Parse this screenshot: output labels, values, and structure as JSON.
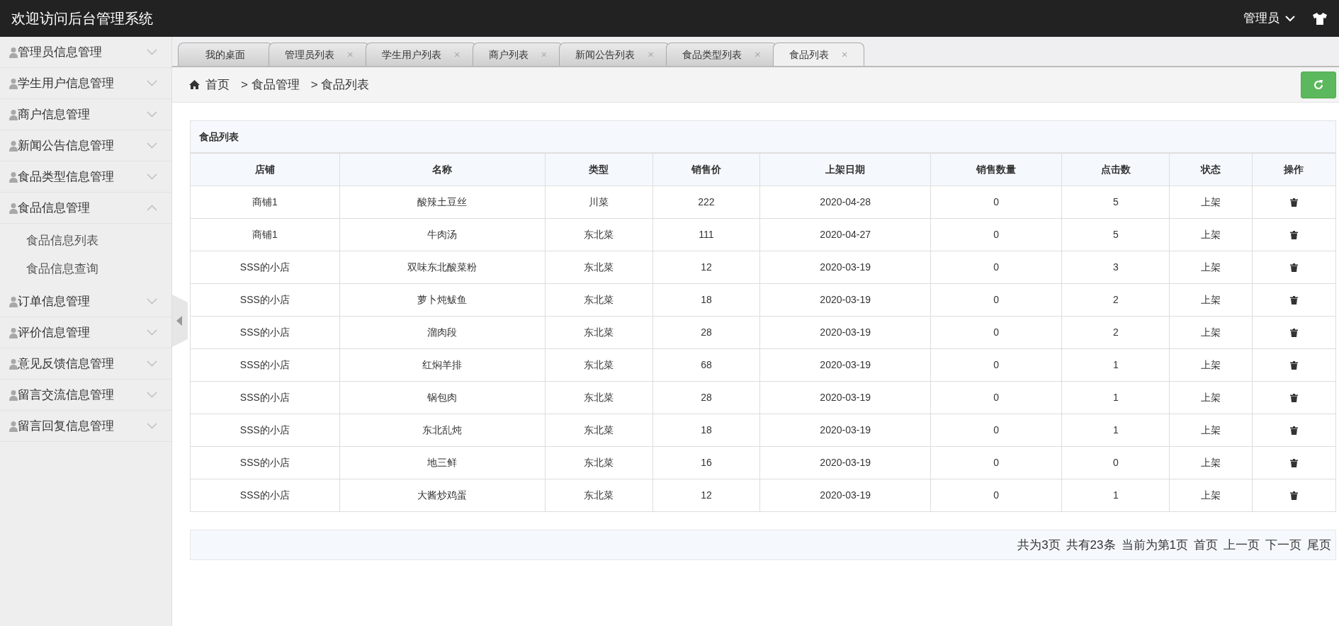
{
  "header": {
    "title": "欢迎访问后台管理系统",
    "user": "管理员"
  },
  "sidebar": {
    "items": [
      {
        "label": "管理员信息管理",
        "expanded": false
      },
      {
        "label": "学生用户信息管理",
        "expanded": false
      },
      {
        "label": "商户信息管理",
        "expanded": false
      },
      {
        "label": "新闻公告信息管理",
        "expanded": false
      },
      {
        "label": "食品类型信息管理",
        "expanded": false
      },
      {
        "label": "食品信息管理",
        "expanded": true,
        "children": [
          {
            "label": "食品信息列表"
          },
          {
            "label": "食品信息查询"
          }
        ]
      },
      {
        "label": "订单信息管理",
        "expanded": false
      },
      {
        "label": "评价信息管理",
        "expanded": false
      },
      {
        "label": "意见反馈信息管理",
        "expanded": false
      },
      {
        "label": "留言交流信息管理",
        "expanded": false
      },
      {
        "label": "留言回复信息管理",
        "expanded": false
      }
    ]
  },
  "tabs": [
    {
      "label": "我的桌面",
      "selected": false
    },
    {
      "label": "管理员列表",
      "selected": false,
      "close": "×"
    },
    {
      "label": "学生用户列表",
      "selected": false,
      "close": "×"
    },
    {
      "label": "商户列表",
      "selected": false,
      "close": "×"
    },
    {
      "label": "新闻公告列表",
      "selected": false,
      "close": "×"
    },
    {
      "label": "食品类型列表",
      "selected": false,
      "close": "×"
    },
    {
      "label": "食品列表",
      "selected": true,
      "close": "×"
    }
  ],
  "breadcrumb": [
    "首页",
    "> 食品管理",
    "> 食品列表"
  ],
  "table": {
    "title": "食品列表",
    "columns": [
      "店铺",
      "名称",
      "类型",
      "销售价",
      "上架日期",
      "销售数量",
      "点击数",
      "状态",
      "操作"
    ],
    "rows": [
      [
        "商铺1",
        "酸辣土豆丝",
        "川菜",
        "222",
        "2020-04-28",
        "0",
        "5",
        "上架"
      ],
      [
        "商铺1",
        "牛肉汤",
        "东北菜",
        "111",
        "2020-04-27",
        "0",
        "5",
        "上架"
      ],
      [
        "SSS的小店",
        "双味东北酸菜粉",
        "东北菜",
        "12",
        "2020-03-19",
        "0",
        "3",
        "上架"
      ],
      [
        "SSS的小店",
        "萝卜炖鲅鱼",
        "东北菜",
        "18",
        "2020-03-19",
        "0",
        "2",
        "上架"
      ],
      [
        "SSS的小店",
        "溜肉段",
        "东北菜",
        "28",
        "2020-03-19",
        "0",
        "2",
        "上架"
      ],
      [
        "SSS的小店",
        "红焖羊排",
        "东北菜",
        "68",
        "2020-03-19",
        "0",
        "1",
        "上架"
      ],
      [
        "SSS的小店",
        "锅包肉",
        "东北菜",
        "28",
        "2020-03-19",
        "0",
        "1",
        "上架"
      ],
      [
        "SSS的小店",
        "东北乱炖",
        "东北菜",
        "18",
        "2020-03-19",
        "0",
        "1",
        "上架"
      ],
      [
        "SSS的小店",
        "地三鲜",
        "东北菜",
        "16",
        "2020-03-19",
        "0",
        "0",
        "上架"
      ],
      [
        "SSS的小店",
        "大酱炒鸡蛋",
        "东北菜",
        "12",
        "2020-03-19",
        "0",
        "1",
        "上架"
      ]
    ]
  },
  "pagination": [
    {
      "label": "共为3页"
    },
    {
      "label": "共有23条"
    },
    {
      "label": "当前为第1页"
    },
    {
      "label": "首页"
    },
    {
      "label": "上一页"
    },
    {
      "label": "下一页"
    },
    {
      "label": "尾页"
    }
  ]
}
